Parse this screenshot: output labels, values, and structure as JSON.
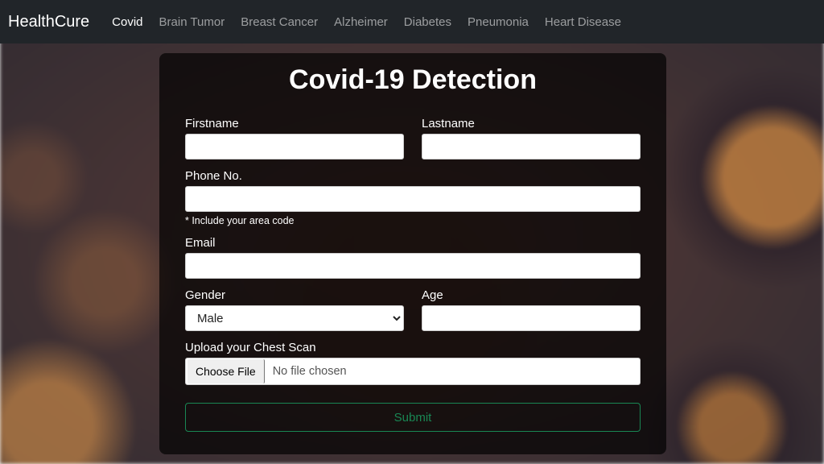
{
  "nav": {
    "brand": "HealthCure",
    "items": [
      {
        "label": "Covid",
        "active": true
      },
      {
        "label": "Brain Tumor",
        "active": false
      },
      {
        "label": "Breast Cancer",
        "active": false
      },
      {
        "label": "Alzheimer",
        "active": false
      },
      {
        "label": "Diabetes",
        "active": false
      },
      {
        "label": "Pneumonia",
        "active": false
      },
      {
        "label": "Heart Disease",
        "active": false
      }
    ]
  },
  "card": {
    "title": "Covid-19 Detection",
    "fields": {
      "firstname": {
        "label": "Firstname",
        "value": ""
      },
      "lastname": {
        "label": "Lastname",
        "value": ""
      },
      "phone": {
        "label": "Phone No.",
        "value": "",
        "hint": "* Include your area code"
      },
      "email": {
        "label": "Email",
        "value": ""
      },
      "gender": {
        "label": "Gender",
        "value": "Male",
        "options": [
          "Male"
        ]
      },
      "age": {
        "label": "Age",
        "value": ""
      },
      "upload": {
        "label": "Upload your Chest Scan",
        "button": "Choose File",
        "status": "No file chosen"
      }
    },
    "submit": "Submit"
  }
}
